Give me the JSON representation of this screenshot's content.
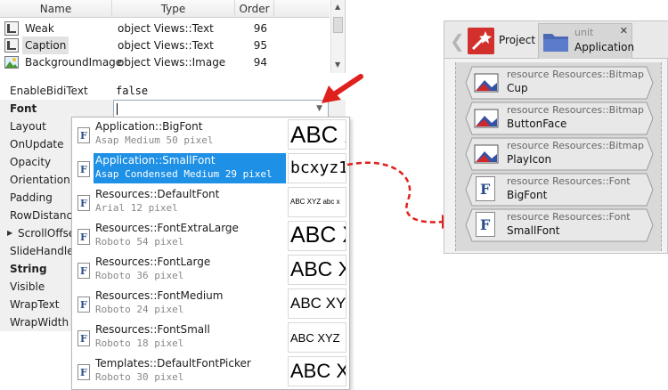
{
  "members": {
    "columns": [
      "Name",
      "Type",
      "Order"
    ],
    "rows": [
      {
        "name": "Weak",
        "type": "object Views::Text",
        "order": "96",
        "icon": "text-member-icon"
      },
      {
        "name": "Caption",
        "type": "object Views::Text",
        "order": "95",
        "icon": "text-member-icon"
      },
      {
        "name": "BackgroundImage",
        "type": "object Views::Image",
        "order": "94",
        "icon": "image-member-icon"
      }
    ]
  },
  "properties": [
    {
      "name": "EnableBidiText",
      "value": "false"
    },
    {
      "name": "Font",
      "value": ""
    },
    {
      "name": "Layout",
      "value": ""
    },
    {
      "name": "OnUpdate",
      "value": ""
    },
    {
      "name": "Opacity",
      "value": ""
    },
    {
      "name": "Orientation",
      "value": ""
    },
    {
      "name": "Padding",
      "value": ""
    },
    {
      "name": "RowDistance",
      "value": ""
    },
    {
      "name": "ScrollOffset",
      "value": ""
    },
    {
      "name": "SlideHandler",
      "value": ""
    },
    {
      "name": "String",
      "value": ""
    },
    {
      "name": "Visible",
      "value": ""
    },
    {
      "name": "WrapText",
      "value": ""
    },
    {
      "name": "WrapWidth",
      "value": ""
    }
  ],
  "fonts": [
    {
      "name": "Application::BigFont",
      "desc": "Asap Medium 50 pixel",
      "preview": "ABC X",
      "selected": false
    },
    {
      "name": "Application::SmallFont",
      "desc": "Asap Condensed Medium 29 pixel",
      "preview": "bcxyz1",
      "selected": true
    },
    {
      "name": "Resources::DefaultFont",
      "desc": "Arial 12 pixel",
      "preview": "ABC XYZ abc x",
      "selected": false
    },
    {
      "name": "Resources::FontExtraLarge",
      "desc": "Roboto 54 pixel",
      "preview": "ABC X",
      "selected": false
    },
    {
      "name": "Resources::FontLarge",
      "desc": "Roboto 36 pixel",
      "preview": "ABC X",
      "selected": false
    },
    {
      "name": "Resources::FontMedium",
      "desc": "Roboto 24 pixel",
      "preview": "ABC XY",
      "selected": false
    },
    {
      "name": "Resources::FontSmall",
      "desc": "Roboto 18 pixel",
      "preview": "ABC XYZ",
      "selected": false
    },
    {
      "name": "Templates::DefaultFontPicker",
      "desc": "Roboto 30 pixel",
      "preview": "ABC X",
      "selected": false
    }
  ],
  "project": {
    "tab_project": "Project",
    "tab_unit_kind": "unit",
    "tab_unit_name": "Application",
    "close_glyph": "✕",
    "back_glyph": "❮",
    "resources": [
      {
        "kind": "resource Resources::Bitmap",
        "name": "Cup",
        "icon": "bitmap-icon"
      },
      {
        "kind": "resource Resources::Bitmap",
        "name": "ButtonFace",
        "icon": "bitmap-icon"
      },
      {
        "kind": "resource Resources::Bitmap",
        "name": "PlayIcon",
        "icon": "bitmap-icon"
      },
      {
        "kind": "resource Resources::Font",
        "name": "BigFont",
        "icon": "font-icon"
      },
      {
        "kind": "resource Resources::Font",
        "name": "SmallFont",
        "icon": "font-icon"
      }
    ]
  },
  "colors": {
    "selection": "#1e90e6",
    "arrow": "#e0201c",
    "project_logo": "#d2302c"
  }
}
